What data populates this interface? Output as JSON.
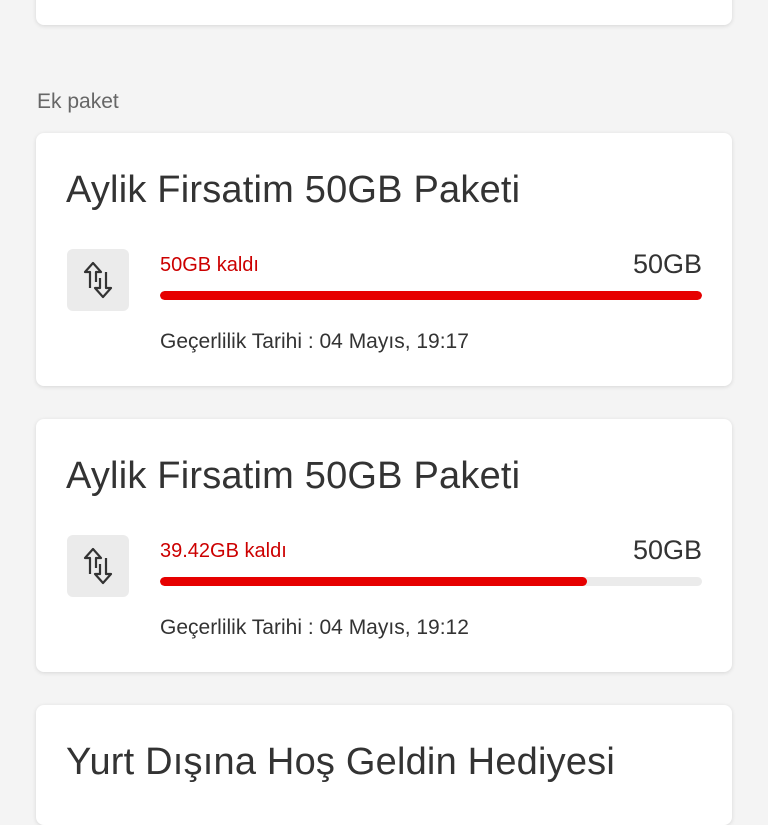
{
  "section": {
    "label": "Ek paket"
  },
  "packages": [
    {
      "title": "Aylik Firsatim 50GB Paketi",
      "remaining_label": "50GB kaldı",
      "total_label": "50GB",
      "remaining_gb": 50,
      "total_gb": 50,
      "validity_label": "Geçerlilik Tarihi :",
      "validity_value": "04 Mayıs, 19:17"
    },
    {
      "title": "Aylik Firsatim 50GB Paketi",
      "remaining_label": "39.42GB kaldı",
      "total_label": "50GB",
      "remaining_gb": 39.42,
      "total_gb": 50,
      "validity_label": "Geçerlilik Tarihi :",
      "validity_value": "04 Mayıs, 19:12"
    },
    {
      "title": "Yurt Dışına Hoş Geldin Hediyesi"
    }
  ],
  "icons": {
    "data_transfer": "data-transfer-icon"
  },
  "colors": {
    "accent": "#e60000",
    "remaining_text": "#cc0000"
  }
}
